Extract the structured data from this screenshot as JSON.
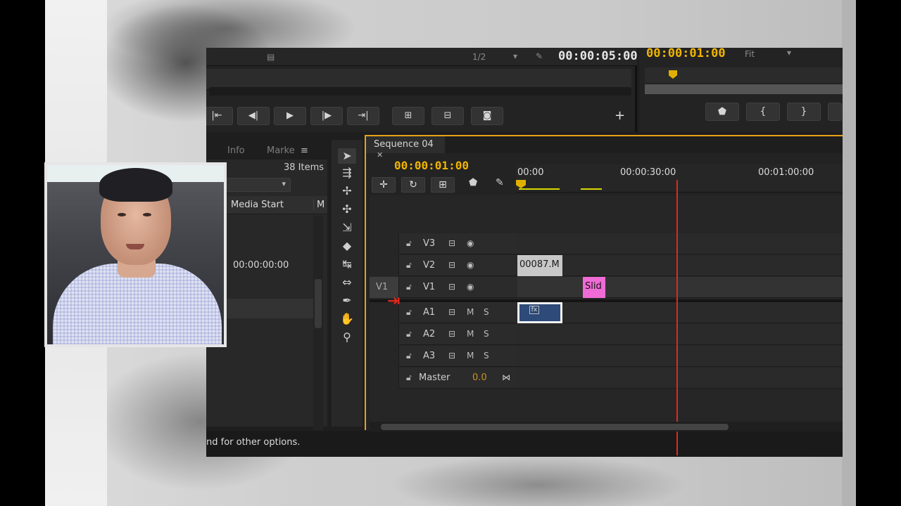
{
  "source_monitor": {
    "zoom": "1/2",
    "timecode": "00:00:05:00"
  },
  "program_monitor": {
    "timecode": "00:00:01:00",
    "fit": "Fit"
  },
  "project_panel": {
    "tabs": [
      "Info",
      "Marke"
    ],
    "items_count": "38 Items",
    "columns": [
      "Media Start",
      "M"
    ],
    "rows": [
      {
        "media_start": "00:00:00:00"
      }
    ]
  },
  "status_bar": {
    "text": "nd for other options."
  },
  "timeline": {
    "tab_label": "Sequence 04",
    "current_timecode": "00:00:01:00",
    "ruler_labels": [
      "00:00",
      "00:00:30:00",
      "00:01:00:00"
    ],
    "source_patch": "V1",
    "tracks": [
      {
        "name": "V3",
        "type": "video"
      },
      {
        "name": "V2",
        "type": "video",
        "clip": "00087.M"
      },
      {
        "name": "V1",
        "type": "video",
        "clip": "Slid"
      },
      {
        "name": "A1",
        "type": "audio",
        "mute": "M",
        "solo": "S"
      },
      {
        "name": "A2",
        "type": "audio",
        "mute": "M",
        "solo": "S"
      },
      {
        "name": "A3",
        "type": "audio",
        "mute": "M",
        "solo": "S"
      }
    ],
    "master": {
      "name": "Master",
      "value": "0.0"
    },
    "clip_a1_fx": "fx"
  },
  "colors": {
    "accent_timecode": "#f0b400",
    "playhead": "#e0281f",
    "clip_graphic": "#f06bd6",
    "clip_audio": "#2d4a78"
  },
  "icons": {
    "tools": [
      "selection-icon",
      "track-select-icon",
      "ripple-edit-icon",
      "rolling-edit-icon",
      "rate-stretch-icon",
      "razor-icon",
      "slip-icon",
      "slide-icon",
      "pen-icon",
      "hand-icon",
      "zoom-icon"
    ]
  }
}
